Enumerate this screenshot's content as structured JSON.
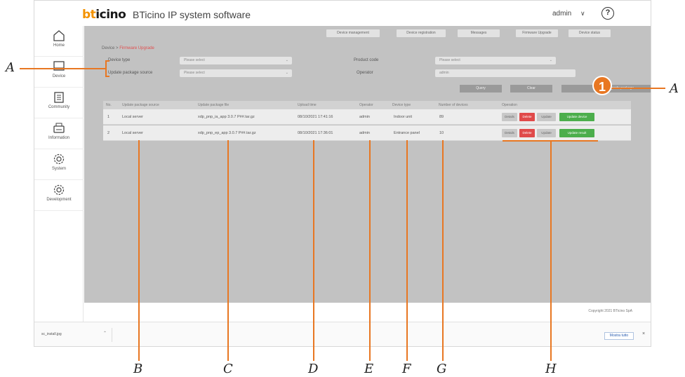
{
  "brand": {
    "logo_b": "bt",
    "logo_rest": "icino",
    "app_title": "BTicino IP system software"
  },
  "header": {
    "user": "admin",
    "user_chevron": "∨",
    "help": "?"
  },
  "sidebar": {
    "items": [
      {
        "label": "Home",
        "icon": "home-icon"
      },
      {
        "label": "Device",
        "icon": "monitor-icon"
      },
      {
        "label": "Community",
        "icon": "building-icon"
      },
      {
        "label": "Information",
        "icon": "printer-icon"
      },
      {
        "label": "System",
        "icon": "gear-icon"
      },
      {
        "label": "Development",
        "icon": "gear-icon"
      }
    ]
  },
  "topnav": [
    "Device management",
    "Device registration",
    "Messages",
    "Firmware Upgrade",
    "Device status"
  ],
  "breadcrumb": {
    "parent": "Device",
    "current": "Firmware Upgrade"
  },
  "filters": {
    "device_type_label": "Device type",
    "device_type_value": "Please select",
    "product_code_label": "Product code",
    "product_code_value": "Please select",
    "source_label": "Update package source",
    "source_value": "Please select",
    "operator_label": "Operator",
    "operator_value": "admin"
  },
  "actions": {
    "query": "Query",
    "clear": "Clear",
    "import": "Import upgrade package"
  },
  "table": {
    "headers": [
      "No.",
      "Update package source",
      "Update package file",
      "Upload time",
      "Operator",
      "Device type",
      "Number of devices",
      "Operation"
    ],
    "rows": [
      {
        "no": "1",
        "source": "Local server",
        "file": "xdp_pnp_ia_app 3.0.7 P##.tar.gz",
        "time": "08/10/2021 17:41:16",
        "operator": "admin",
        "device_type": "Indoor unit",
        "devices": "89",
        "last_btn": "Update device"
      },
      {
        "no": "2",
        "source": "Local server",
        "file": "xdp_pnp_ep_app 3.0.7 P##.tar.gz",
        "time": "08/10/2021 17:36:01",
        "operator": "admin",
        "device_type": "Entrance panel",
        "devices": "10",
        "last_btn": "Update result"
      }
    ],
    "op_buttons": {
      "details": "Details",
      "delete": "Delete",
      "update": "Update"
    }
  },
  "footer": {
    "copyright": "Copyright 2021 BTicino SpA"
  },
  "downloads": {
    "file": "sc_install.jpg",
    "arrow": "⌃",
    "show_all": "Mostra tutto",
    "close": "×"
  },
  "annotations": {
    "A": "A",
    "B": "B",
    "C": "C",
    "D": "D",
    "E": "E",
    "F": "F",
    "G": "G",
    "H": "H",
    "badge": "1"
  },
  "colors": {
    "accent": "#e87722",
    "brand_orange": "#f39200",
    "delete_red": "#e04a4a",
    "green": "#4cae4c"
  }
}
